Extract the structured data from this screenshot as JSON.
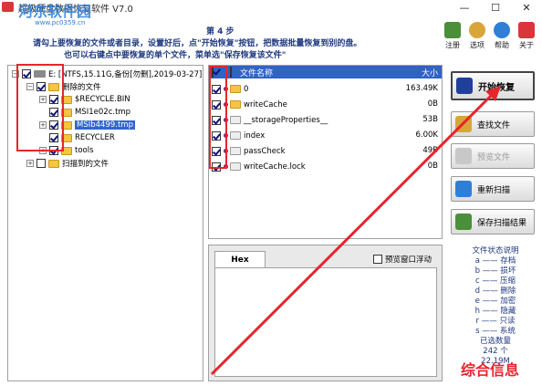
{
  "window": {
    "title": "超级硬盘数据恢复软件 V7.0",
    "watermark_site": "河东软件园",
    "watermark_url": "www.pc0359.cn",
    "controls": {
      "minimize": "—",
      "maximize": "☐",
      "close": "✕"
    }
  },
  "instructions": {
    "step": "第 4 步",
    "line1": "请勾上要恢复的文件或者目录，设置好后，点\"开始恢复\"按钮，把数据批量恢复到别的盘。",
    "line2": "也可以右键点中要恢复的单个文件，菜单选\"保存恢复该文件\""
  },
  "toolbar": {
    "items": [
      {
        "label": "注册",
        "icon": "register-icon",
        "color": "#4a8f3a"
      },
      {
        "label": "选项",
        "icon": "options-icon",
        "color": "#d9a53a"
      },
      {
        "label": "帮助",
        "icon": "help-icon",
        "color": "#2f7fd6"
      },
      {
        "label": "关于",
        "icon": "about-icon",
        "color": "#d9353a"
      }
    ]
  },
  "tree": {
    "root": "E:  [NTFS,15.11G,备份[勿删],2019-03-27]",
    "deleted_files": "删除的文件",
    "children": [
      "$RECYCLE.BIN",
      "MSI1e02c.tmp",
      "MSIb4499.tmp",
      "RECYCLER",
      "tools"
    ],
    "scanned_files": "扫描到的文件"
  },
  "file_list": {
    "columns": {
      "name": "文件名称",
      "size": "大小"
    },
    "rows": [
      {
        "name": "0",
        "size": "163.49K"
      },
      {
        "name": "writeCache",
        "size": "0B"
      },
      {
        "name": "__storageProperties__",
        "size": "53B"
      },
      {
        "name": "index",
        "size": "6.00K"
      },
      {
        "name": "passCheck",
        "size": "49B"
      },
      {
        "name": "writeCache.lock",
        "size": "0B"
      }
    ]
  },
  "hex": {
    "tab": "Hex",
    "float_label": "预览窗口浮动"
  },
  "actions": {
    "start": "开始恢复",
    "find": "查找文件",
    "preview": "预览文件",
    "rescan": "重新扫描",
    "save_scan": "保存扫描结果"
  },
  "legend": {
    "title": "文件状态说明",
    "items": [
      "a —— 存档",
      "b —— 损坏",
      "c —— 压缩",
      "d —— 删除",
      "e —— 加密",
      "h —— 隐藏",
      "r —— 只读",
      "s —— 系统"
    ],
    "selected_label": "已选数量",
    "selected_count": "242 个",
    "selected_size": "22.19M"
  },
  "watermark_brand": "综合信息",
  "colors": {
    "accent": "#2f63c4",
    "annotation": "#e5262c",
    "instruction_text": "#203a80"
  }
}
